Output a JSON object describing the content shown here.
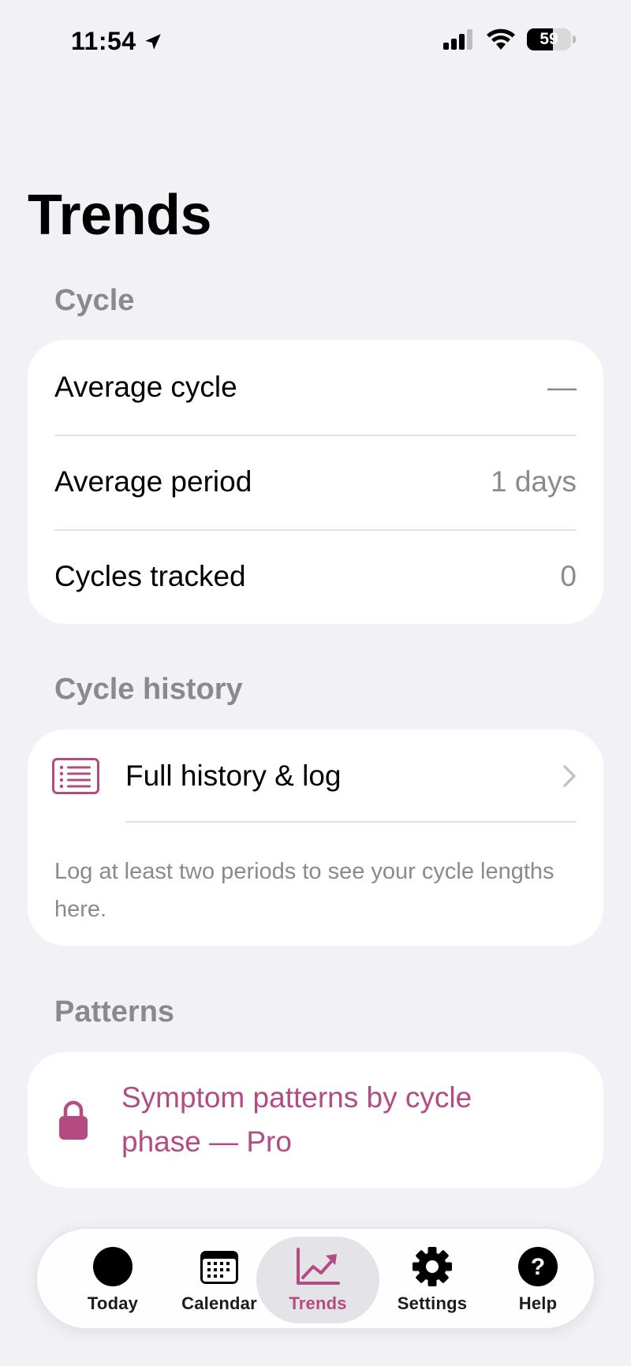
{
  "status": {
    "time": "11:54",
    "battery": 59
  },
  "page": {
    "title": "Trends"
  },
  "cycle": {
    "header": "Cycle",
    "rows": [
      {
        "label": "Average cycle",
        "value": "—"
      },
      {
        "label": "Average period",
        "value": "1 days"
      },
      {
        "label": "Cycles tracked",
        "value": "0"
      }
    ]
  },
  "history": {
    "header": "Cycle history",
    "link_label": "Full history & log",
    "note": "Log at least two periods to see your cycle lengths here."
  },
  "patterns": {
    "header": "Patterns",
    "pro_label": "Symptom patterns by cycle phase — Pro"
  },
  "tabs": [
    {
      "label": "Today",
      "icon": "circle-icon"
    },
    {
      "label": "Calendar",
      "icon": "calendar-icon"
    },
    {
      "label": "Trends",
      "icon": "chart-trend-icon",
      "active": true
    },
    {
      "label": "Settings",
      "icon": "gear-icon"
    },
    {
      "label": "Help",
      "icon": "question-icon"
    }
  ],
  "colors": {
    "accent": "#b44b82",
    "background": "#f2f1f6",
    "secondary_text": "#8a8a8e"
  }
}
